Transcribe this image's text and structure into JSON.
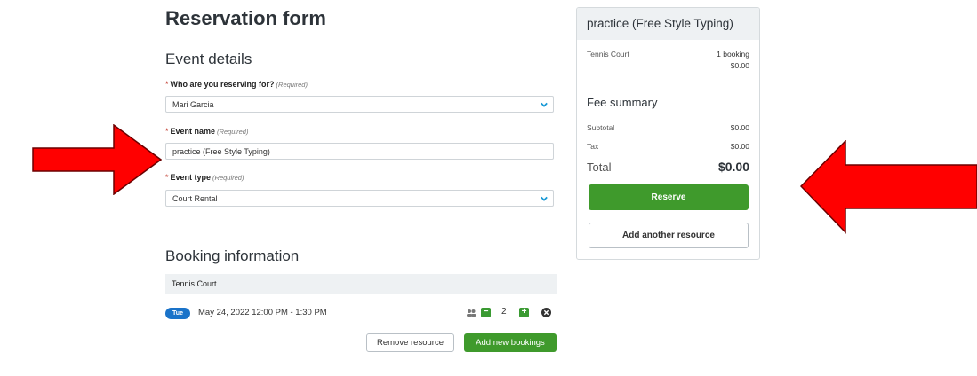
{
  "form": {
    "title": "Reservation form",
    "event_details_heading": "Event details",
    "who_label": "Who are you reserving for?",
    "who_hint": "(Required)",
    "who_value": "Mari Garcia",
    "event_name_label": "Event name",
    "event_name_hint": "(Required)",
    "event_name_value": "practice (Free Style Typing)",
    "event_type_label": "Event type",
    "event_type_hint": "(Required)",
    "event_type_value": "Court Rental",
    "required_mark": "*"
  },
  "booking": {
    "heading": "Booking information",
    "resource": "Tennis Court",
    "day_badge": "Tue",
    "datetime": "May 24, 2022 12:00 PM - 1:30 PM",
    "attendee_count": "2",
    "minus": "−",
    "plus": "+",
    "remove_resource_label": "Remove resource",
    "add_bookings_label": "Add new bookings"
  },
  "summary": {
    "title": "practice (Free Style Typing)",
    "resource_name": "Tennis Court",
    "bookings_count": "1 booking",
    "resource_amount": "$0.00",
    "fee_heading": "Fee summary",
    "subtotal_label": "Subtotal",
    "subtotal_value": "$0.00",
    "tax_label": "Tax",
    "tax_value": "$0.00",
    "total_label": "Total",
    "total_value": "$0.00",
    "reserve_label": "Reserve",
    "add_resource_label": "Add another resource"
  },
  "colors": {
    "arrow": "#ff0000",
    "accent_green": "#3f9a2c",
    "accent_blue": "#1a73c9",
    "chevron_blue": "#1a9ad6"
  },
  "icons": [
    "right-arrow-annotation",
    "left-arrow-annotation",
    "chevron-down-icon",
    "people-icon",
    "minus-icon",
    "plus-icon",
    "close-icon"
  ]
}
